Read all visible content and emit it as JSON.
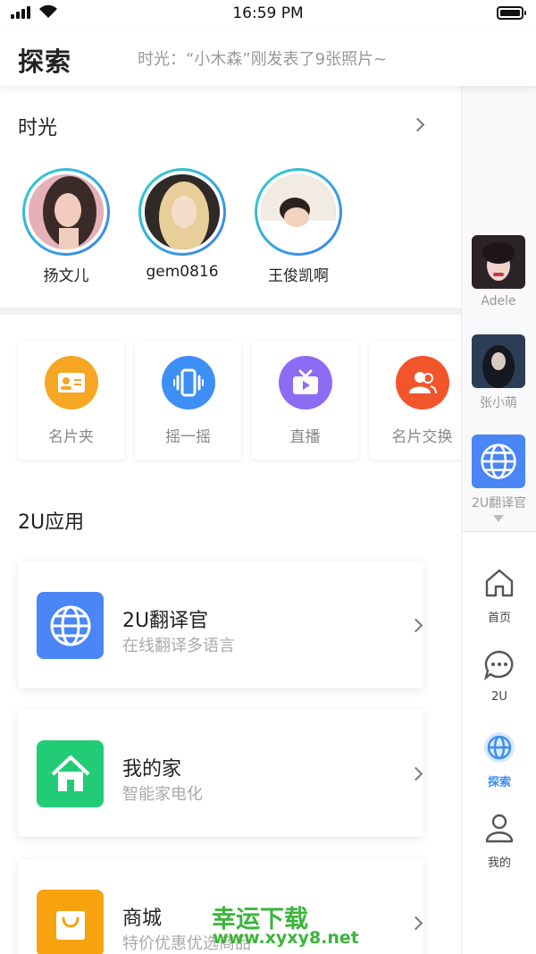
{
  "status_bar": {
    "time": "16:59 PM"
  },
  "header": {
    "title": "探索",
    "ticker": "时光：“小木森”刚发表了9张照片~"
  },
  "moments": {
    "title": "时光",
    "people": [
      {
        "name": "扬文儿"
      },
      {
        "name": "gem0816"
      },
      {
        "name": "王俊凯啊"
      }
    ]
  },
  "shortcuts": [
    {
      "label": "名片夹",
      "icon": "card-holder-icon",
      "color": "#f6a623"
    },
    {
      "label": "摇一摇",
      "icon": "shake-phone-icon",
      "color": "#3d8ff5"
    },
    {
      "label": "直播",
      "icon": "live-tv-icon",
      "color": "#8c6cf2"
    },
    {
      "label": "名片交换",
      "icon": "exchange-contacts-icon",
      "color": "#f2552c"
    }
  ],
  "apps": {
    "title": "2U应用",
    "items": [
      {
        "name": "2U翻译官",
        "desc": "在线翻译多语言",
        "icon": "globe-icon",
        "color": "#4a86f5"
      },
      {
        "name": "我的家",
        "desc": "智能家电化",
        "icon": "house-icon",
        "color": "#22cc77"
      },
      {
        "name": "商城",
        "desc": "特价优惠优选商品",
        "icon": "shopping-bag-icon",
        "color": "#f6a30f"
      }
    ]
  },
  "watermark": {
    "title": "幸运下载",
    "url": "www.xyxy8.net"
  },
  "rail": {
    "contacts": [
      {
        "name": "Adele"
      },
      {
        "name": "张小萌"
      },
      {
        "name": "2U翻译官"
      }
    ],
    "tabs": [
      {
        "label": "首页",
        "icon": "home-icon",
        "active": false
      },
      {
        "label": "2U",
        "icon": "chat-bubble-icon",
        "active": false
      },
      {
        "label": "探索",
        "icon": "explore-globe-icon",
        "active": true
      },
      {
        "label": "我的",
        "icon": "person-icon",
        "active": false
      }
    ]
  },
  "colors": {
    "accent": "#3e8df0",
    "ring_start": "#2fd3c9",
    "ring_end": "#3e7df0",
    "watermark": "#3cb43a"
  }
}
